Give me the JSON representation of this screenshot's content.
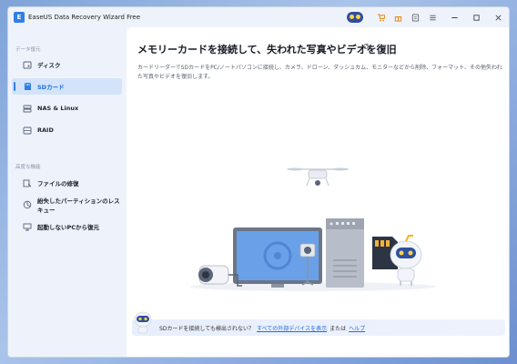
{
  "window": {
    "title": "EaseUS Data Recovery Wizard Free"
  },
  "titlebar": {
    "icons": [
      "mascot-icon",
      "cart-icon",
      "gift-icon",
      "info-icon",
      "menu-icon",
      "minimize-icon",
      "maximize-icon",
      "close-icon"
    ]
  },
  "sidebar": {
    "section1": "データ復元",
    "section2": "高度な機能",
    "items": [
      {
        "label": "ディスク",
        "icon": "disk-icon"
      },
      {
        "label": "SDカード",
        "icon": "sdcard-icon",
        "active": true
      },
      {
        "label": "NAS & Linux",
        "icon": "nas-icon"
      },
      {
        "label": "RAID",
        "icon": "raid-icon"
      },
      {
        "label": "ファイルの修復",
        "icon": "repair-icon"
      },
      {
        "label": "紛失したパーティションのレスキュー",
        "icon": "partition-icon"
      },
      {
        "label": "起動しないPCから復元",
        "icon": "pc-icon"
      }
    ]
  },
  "main": {
    "heading": "メモリーカードを接続して、失われた写真やビデオを復旧",
    "description": "カードリーダーでSDカードをPC/ノートパソコンに接続し、カメラ、ドローン、ダッシュカム、モニターなどから削除、フォーマット、その他失われた写真やビデオを復旧します。"
  },
  "bottom": {
    "text": "SDカードを接続しても検出されない？",
    "link1": "すべての外部デバイスを表示",
    "or": "または",
    "link2": "ヘルプ"
  },
  "colors": {
    "accent": "#2f7fe6",
    "active_bg": "#d3e3fa"
  }
}
